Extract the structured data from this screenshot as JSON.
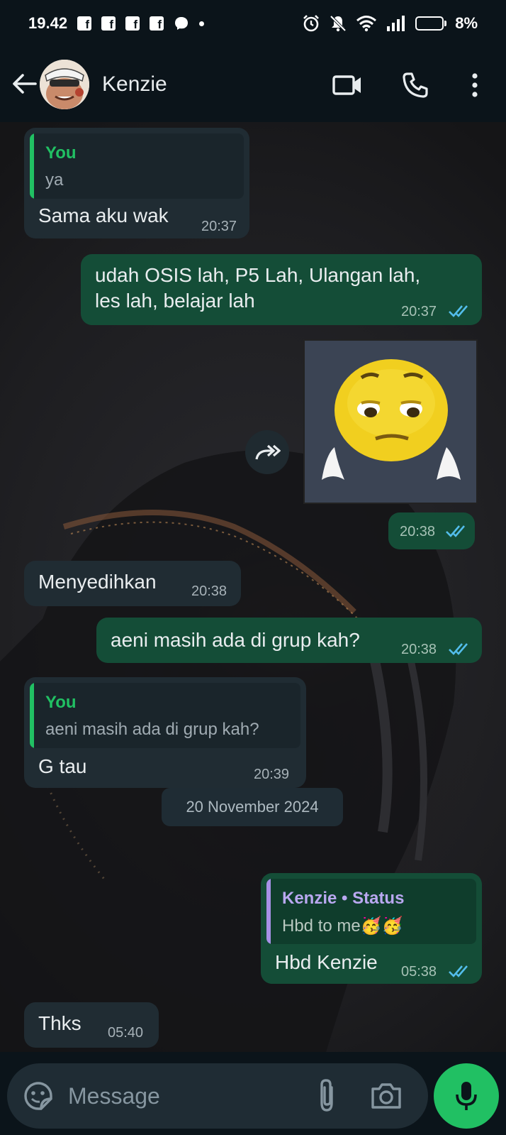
{
  "status_bar": {
    "time": "19.42",
    "notification_icons": [
      "facebook-icon",
      "facebook-icon",
      "facebook-icon",
      "facebook-icon",
      "messenger-icon",
      "dot-icon"
    ],
    "battery": "8%",
    "battery_level": 0.08
  },
  "header": {
    "contact_name": "Kenzie",
    "icons": [
      "back-arrow-icon",
      "avatar",
      "video-call-icon",
      "phone-icon",
      "more-vert-icon"
    ]
  },
  "messages": [
    {
      "dir": "in",
      "quote_author": "You",
      "quote_text": "ya",
      "text": "Sama aku wak",
      "time": "20:37"
    },
    {
      "dir": "out",
      "text_line1": "udah OSIS lah, P5 Lah, Ulangan lah,",
      "text_line2": "les lah, belajar lah",
      "time": "20:37",
      "read": true
    },
    {
      "dir": "out",
      "type": "sticker",
      "sticker": "sad-emoji-sticker",
      "time": "20:38",
      "read": true
    },
    {
      "dir": "in",
      "text": "Menyedihkan",
      "time": "20:38"
    },
    {
      "dir": "out",
      "text": "aeni masih ada di grup kah?",
      "time": "20:38",
      "read": true
    },
    {
      "dir": "in",
      "quote_author": "You",
      "quote_text": "aeni masih ada di grup kah?",
      "text": "G tau",
      "time": "20:39"
    },
    {
      "dir": "date",
      "text": "20 November 2024"
    },
    {
      "dir": "out",
      "quote_author": "Kenzie • Status",
      "quote_text": "Hbd to me🥳🥳",
      "text": "Hbd Kenzie",
      "time": "05:38",
      "read": true
    },
    {
      "dir": "in",
      "text": "Thks",
      "time": "05:40"
    }
  ],
  "composer": {
    "placeholder": "Message",
    "icons": [
      "emoji-sticker-icon",
      "attach-icon",
      "camera-icon",
      "mic-icon"
    ]
  },
  "colors": {
    "incoming_bubble": "#202c33",
    "outgoing_bubble": "#144d37",
    "you_quote_bar": "#21c063",
    "status_quote_bar": "#a791e6",
    "read_ticks": "#53bdeb",
    "mic_button": "#21c063"
  }
}
